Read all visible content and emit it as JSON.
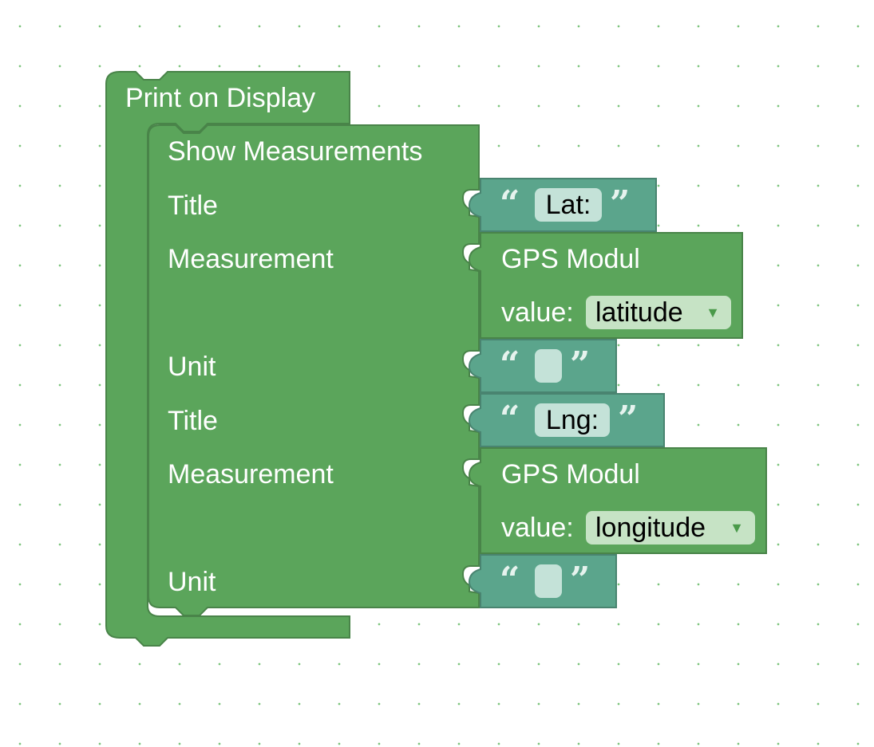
{
  "colors": {
    "procedure_block": "#5ba55b",
    "procedure_block_border": "#498449",
    "text_block": "#5ba58c",
    "text_block_border": "#498470",
    "grid_dot": "#7cc47c"
  },
  "print_block": {
    "label": "Print on Display"
  },
  "show_block": {
    "label": "Show Measurements",
    "inputs": [
      {
        "label": "Title"
      },
      {
        "label": "Measurement"
      },
      {
        "label": "Unit"
      },
      {
        "label": "Title"
      },
      {
        "label": "Measurement"
      },
      {
        "label": "Unit"
      }
    ]
  },
  "text_blocks": [
    {
      "value": "Lat:",
      "open_quote": "“",
      "close_quote": "”"
    },
    {
      "value": "",
      "open_quote": "“",
      "close_quote": "”"
    },
    {
      "value": "Lng:",
      "open_quote": "“",
      "close_quote": "”"
    },
    {
      "value": "",
      "open_quote": "“",
      "close_quote": "”"
    }
  ],
  "sensor_blocks": [
    {
      "title": "GPS Modul",
      "value_label": "value:",
      "selected": "latitude",
      "arrow": "▼"
    },
    {
      "title": "GPS Modul",
      "value_label": "value:",
      "selected": "longitude",
      "arrow": "▼"
    }
  ]
}
